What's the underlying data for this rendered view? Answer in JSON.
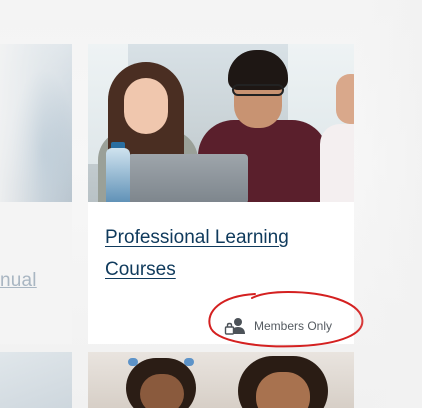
{
  "cards": {
    "left": {
      "title_fragment": "nual"
    },
    "main": {
      "title": "Professional Learning Courses",
      "badge": {
        "label": "Members Only",
        "icon": "lock-user-icon"
      }
    }
  },
  "annotation": {
    "type": "hand-drawn circle",
    "color": "#d42020"
  },
  "colors": {
    "title_link": "#0f3a5c",
    "badge_text": "#555b61",
    "card_bg": "#ffffff",
    "page_bg": "#f2f2f2"
  }
}
